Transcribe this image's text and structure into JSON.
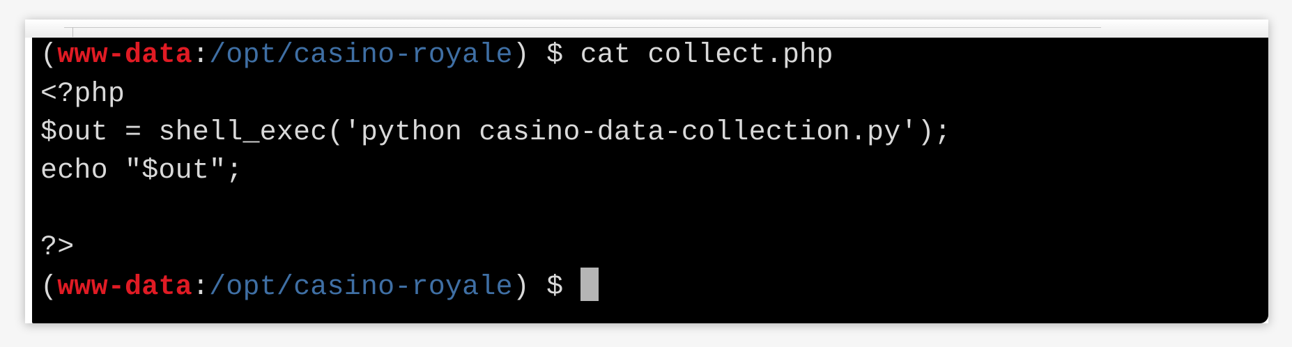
{
  "terminal": {
    "prompt": {
      "open_paren": "(",
      "user": "www-data",
      "separator": ":",
      "path": "/opt/casino-royale",
      "close_paren": ")",
      "symbol": " $ "
    },
    "lines": [
      "cat collect.php",
      "<?php",
      "$out = shell_exec('python casino-data-collection.py');",
      "echo \"$out\";",
      "",
      "?>"
    ],
    "colors": {
      "background": "#000000",
      "text": "#d9d9d9",
      "user": "#e01b24",
      "path": "#3f6fa4",
      "cursor": "#b5b5b5"
    }
  }
}
